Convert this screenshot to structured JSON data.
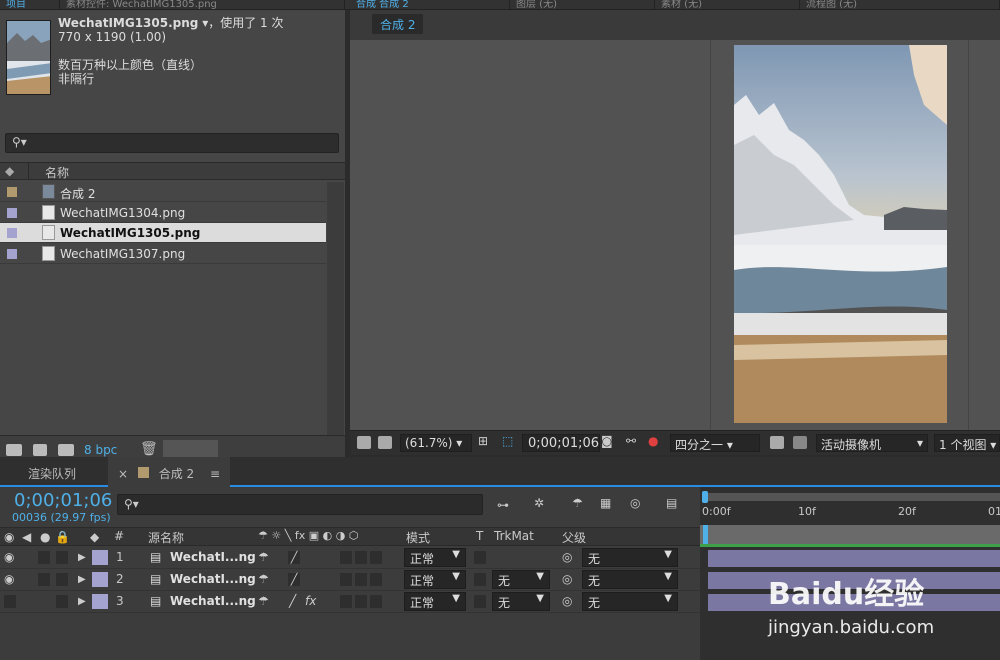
{
  "top_tabs": {
    "project_tab": "项目",
    "footage_tab": "素材控件: WechatIMG1305.png",
    "comp_tab": "合成 合成 2",
    "layer_tab": "图层 (无)",
    "footage2_tab": "素材 (无)",
    "flowchart_tab": "流程图 (无)"
  },
  "project": {
    "file_name": "WechatIMG1305.png",
    "usage": "，使用了 1 次",
    "dimensions": "770 x 1190 (1.00)",
    "colors": "数百万种以上颜色（直线）",
    "interlace": "非隔行",
    "search_icon": "search-icon",
    "column_name": "名称",
    "items": [
      {
        "name": "合成 2",
        "type": "composition",
        "label_color": "#b09a6e"
      },
      {
        "name": "WechatIMG1304.png",
        "type": "footage",
        "label_color": "#a4a2cf"
      },
      {
        "name": "WechatIMG1305.png",
        "type": "footage",
        "label_color": "#a4a2cf",
        "selected": true
      },
      {
        "name": "WechatIMG1307.png",
        "type": "footage",
        "label_color": "#a4a2cf"
      }
    ],
    "bpc": "8 bpc"
  },
  "viewer": {
    "comp_tab": "合成 2",
    "zoom": "(61.7%)",
    "timecode": "0;00;01;06",
    "resolution": "四分之一",
    "camera": "活动摄像机",
    "views": "1 个视图"
  },
  "timeline": {
    "render_queue_tab": "渲染队列",
    "comp_tab": "合成 2",
    "timecode": "0;00;01;06",
    "frames_fps": "00036 (29.97 fps)",
    "headers": {
      "num": "#",
      "source": "源名称",
      "mode": "模式",
      "t": "T",
      "trkmat": "TrkMat",
      "parent": "父级"
    },
    "layers": [
      {
        "num": "1",
        "name": "WechatI...ng",
        "mode": "正常",
        "trkmat": "",
        "parent": "无",
        "fx": false
      },
      {
        "num": "2",
        "name": "WechatI...ng",
        "mode": "正常",
        "trkmat": "无",
        "parent": "无",
        "fx": false
      },
      {
        "num": "3",
        "name": "WechatI...ng",
        "mode": "正常",
        "trkmat": "无",
        "parent": "无",
        "fx": true
      }
    ],
    "ruler": {
      "t0": "0:00f",
      "t1": "10f",
      "t2": "20f",
      "t3": "01"
    }
  },
  "watermark": {
    "logo": "Baidu经验",
    "url": "jingyan.baidu.com"
  },
  "colors": {
    "accent": "#4fb0e8",
    "panel": "#464646",
    "track": "#7b77a3",
    "label": "#a4a2cf"
  }
}
